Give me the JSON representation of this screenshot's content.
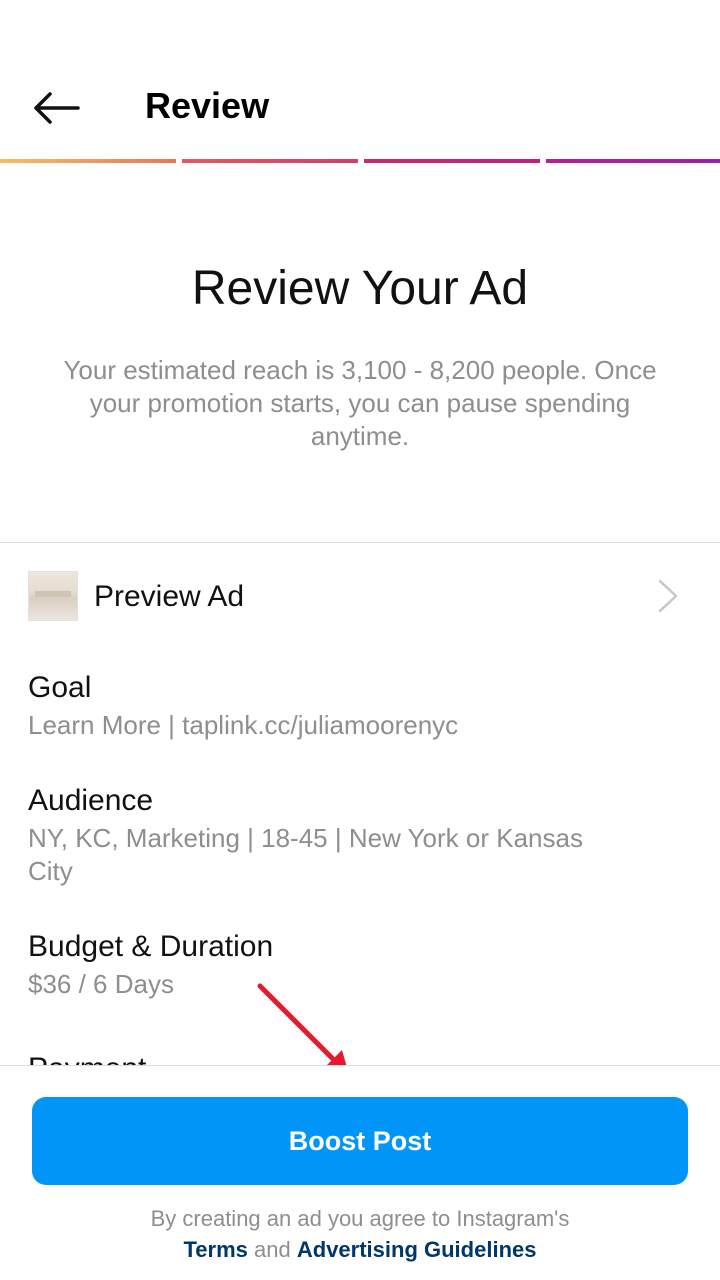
{
  "header": {
    "title": "Review",
    "back_icon": "arrow-left-icon"
  },
  "progress": {
    "steps_total": 4,
    "steps_completed": 4,
    "colors": [
      "#f5c160",
      "#e45a60",
      "#c82a72",
      "#9a1fa8"
    ]
  },
  "hero": {
    "title": "Review Your Ad",
    "description": "Your estimated reach is 3,100 - 8,200 people. Once your promotion starts, you can pause spending anytime."
  },
  "preview": {
    "label": "Preview Ad",
    "chevron_icon": "chevron-right-icon"
  },
  "sections": {
    "goal": {
      "title": "Goal",
      "value": "Learn More | taplink.cc/juliamoorenyc"
    },
    "audience": {
      "title": "Audience",
      "value": "NY, KC, Marketing | 18-45 | New York or Kansas City"
    },
    "budget": {
      "title": "Budget & Duration",
      "value": "$36 / 6 Days"
    },
    "payment": {
      "title": "Payment"
    }
  },
  "footer": {
    "boost_label": "Boost Post",
    "legal_prefix": "By creating an ad you agree to Instagram's",
    "terms_label": "Terms",
    "and_label": "and",
    "guidelines_label": "Advertising Guidelines"
  },
  "colors": {
    "accent": "#0095f6",
    "link": "#00376b",
    "secondary_text": "#8e8e8e",
    "annotation": "#e8192c"
  }
}
